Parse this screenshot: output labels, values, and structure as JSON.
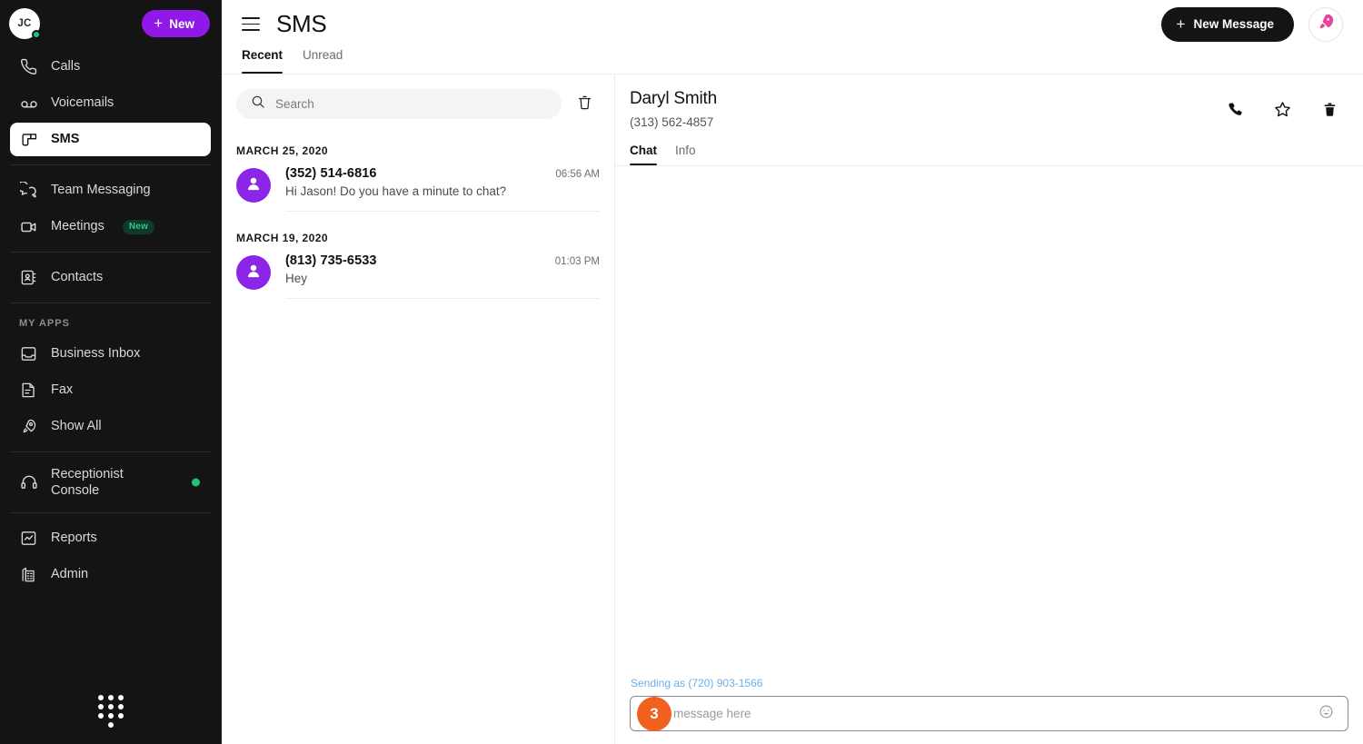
{
  "sidebar": {
    "user": {
      "initials": "JC",
      "presence": "online"
    },
    "new_button": {
      "label": "New",
      "icon": "plus-icon"
    },
    "primary_items": [
      {
        "label": "Calls",
        "icon": "phone-icon",
        "active": false
      },
      {
        "label": "Voicemails",
        "icon": "voicemail-icon",
        "active": false
      },
      {
        "label": "SMS",
        "icon": "sms-icon",
        "active": true
      }
    ],
    "secondary_items": [
      {
        "label": "Team Messaging",
        "icon": "chat-bubbles-icon"
      },
      {
        "label": "Meetings",
        "icon": "video-camera-icon",
        "badge": "New"
      }
    ],
    "contacts_items": [
      {
        "label": "Contacts",
        "icon": "contact-card-icon"
      }
    ],
    "my_apps_title": "MY APPS",
    "my_apps_items": [
      {
        "label": "Business Inbox",
        "icon": "inbox-icon"
      },
      {
        "label": "Fax",
        "icon": "fax-icon"
      },
      {
        "label": "Show All",
        "icon": "rocket-icon"
      }
    ],
    "console_items": [
      {
        "label": "Receptionist\nConsole",
        "icon": "headset-icon",
        "status": "online"
      }
    ],
    "footer_items": [
      {
        "label": "Reports",
        "icon": "chart-icon"
      },
      {
        "label": "Admin",
        "icon": "building-icon"
      }
    ],
    "dialpad_icon": "dialpad-icon"
  },
  "header": {
    "menu_icon": "hamburger-icon",
    "title": "SMS",
    "new_message_label": "New Message",
    "rocket_icon": "rocket-icon",
    "tabs": [
      {
        "label": "Recent",
        "active": true
      },
      {
        "label": "Unread",
        "active": false
      }
    ]
  },
  "conversation_list": {
    "search": {
      "placeholder": "Search",
      "value": "",
      "icon": "search-icon"
    },
    "delete_icon": "trash-icon",
    "groups": [
      {
        "date": "MARCH 25, 2020",
        "items": [
          {
            "name": "(352) 514-6816",
            "time": "06:56 AM",
            "preview": "Hi Jason! Do you have a minute to chat?",
            "avatar_icon": "person-icon"
          }
        ]
      },
      {
        "date": "MARCH 19, 2020",
        "items": [
          {
            "name": "(813) 735-6533",
            "time": "01:03 PM",
            "preview": "Hey",
            "avatar_icon": "person-icon"
          }
        ]
      }
    ]
  },
  "chat_panel": {
    "contact_name": "Daryl Smith",
    "contact_phone": "(313) 562-4857",
    "actions": [
      {
        "icon": "phone-icon",
        "name": "call"
      },
      {
        "icon": "star-icon",
        "name": "favorite"
      },
      {
        "icon": "trash-icon",
        "name": "delete"
      }
    ],
    "tabs": [
      {
        "label": "Chat",
        "active": true
      },
      {
        "label": "Info",
        "active": false
      }
    ],
    "messages": [],
    "sending_as": "Sending as (720) 903-1566",
    "composer": {
      "placeholder": "Type message here",
      "value": "",
      "emoji_icon": "emoji-smiley-icon"
    },
    "step_badge": "3"
  },
  "colors": {
    "sidebar_bg": "#141414",
    "brand_purple": "#9019e8",
    "avatar_purple": "#8b25e8",
    "presence_green": "#20c279",
    "badge_orange": "#f2601f",
    "link_blue": "#6ab0e8",
    "dark_button": "#141414"
  }
}
